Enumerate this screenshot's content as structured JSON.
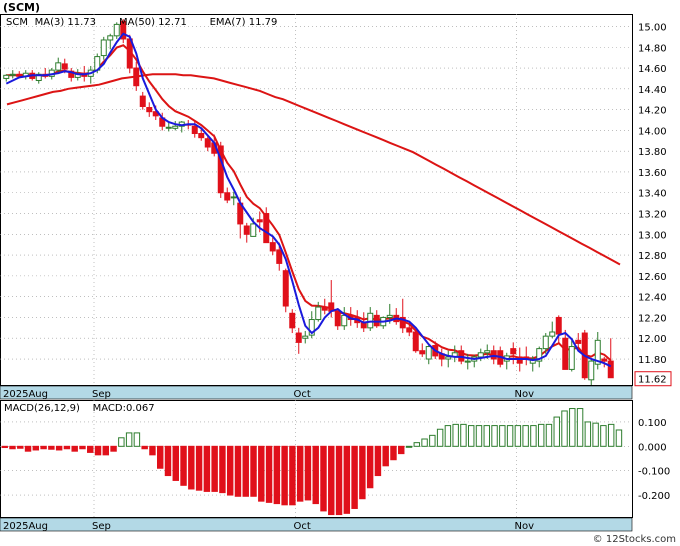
{
  "title": "(SCM)",
  "watermark": "© 12Stocks.com",
  "colors": {
    "up": "#2e7d2e",
    "down": "#e0101a",
    "ma3": "#1a1adc",
    "ma50": "#dc1414",
    "ema7": "#dc1414",
    "date_band": "#b3d9e6",
    "grid": "#999999",
    "last_price_box": "#e0101a"
  },
  "chart_data": [
    {
      "type": "candlestick",
      "name": "price",
      "legend": [
        {
          "label": "SCM",
          "value": ""
        },
        {
          "label": "MA(3)",
          "value": "11.73"
        },
        {
          "label": "MA(50)",
          "value": "12.71"
        },
        {
          "label": "EMA(7)",
          "value": "11.79"
        }
      ],
      "ylim": [
        11.55,
        15.12
      ],
      "y_ticks": [
        "15.00",
        "14.80",
        "14.60",
        "14.40",
        "14.20",
        "14.00",
        "13.80",
        "13.60",
        "13.40",
        "13.20",
        "13.00",
        "12.80",
        "12.60",
        "12.40",
        "12.20",
        "12.00",
        "11.80"
      ],
      "x_labels": [
        {
          "label": "2025Aug",
          "index": 0
        },
        {
          "label": "Sep",
          "index": 14
        },
        {
          "label": "Oct",
          "index": 45
        },
        {
          "label": "Nov",
          "index": 79
        }
      ],
      "last_price": "11.62",
      "candles": [
        [
          14.5,
          14.54,
          14.47,
          14.53
        ],
        [
          14.53,
          14.58,
          14.5,
          14.54
        ],
        [
          14.54,
          14.57,
          14.5,
          14.52
        ],
        [
          14.52,
          14.58,
          14.49,
          14.55
        ],
        [
          14.55,
          14.58,
          14.48,
          14.5
        ],
        [
          14.48,
          14.56,
          14.45,
          14.54
        ],
        [
          14.54,
          14.6,
          14.5,
          14.52
        ],
        [
          14.52,
          14.6,
          14.49,
          14.58
        ],
        [
          14.58,
          14.7,
          14.55,
          14.65
        ],
        [
          14.64,
          14.69,
          14.55,
          14.59
        ],
        [
          14.57,
          14.6,
          14.47,
          14.51
        ],
        [
          14.51,
          14.59,
          14.48,
          14.54
        ],
        [
          14.54,
          14.62,
          14.47,
          14.52
        ],
        [
          14.52,
          14.62,
          14.45,
          14.58
        ],
        [
          14.58,
          14.74,
          14.55,
          14.71
        ],
        [
          14.72,
          14.9,
          14.68,
          14.87
        ],
        [
          14.87,
          14.93,
          14.78,
          14.91
        ],
        [
          14.91,
          15.04,
          14.88,
          15.02
        ],
        [
          15.05,
          15.07,
          14.84,
          14.88
        ],
        [
          14.88,
          14.92,
          14.55,
          14.6
        ],
        [
          14.6,
          14.66,
          14.38,
          14.43
        ],
        [
          14.33,
          14.37,
          14.2,
          14.23
        ],
        [
          14.22,
          14.27,
          14.13,
          14.18
        ],
        [
          14.18,
          14.24,
          14.1,
          14.14
        ],
        [
          14.12,
          14.17,
          14.0,
          14.04
        ],
        [
          14.03,
          14.08,
          13.99,
          14.03
        ],
        [
          14.02,
          14.09,
          14.0,
          14.04
        ],
        [
          14.04,
          14.09,
          13.98,
          14.08
        ],
        [
          14.06,
          14.1,
          14.01,
          14.05
        ],
        [
          14.04,
          14.09,
          13.93,
          13.97
        ],
        [
          13.97,
          14.02,
          13.9,
          13.93
        ],
        [
          13.92,
          13.96,
          13.8,
          13.84
        ],
        [
          13.88,
          13.96,
          13.75,
          13.78
        ],
        [
          13.85,
          13.89,
          13.35,
          13.4
        ],
        [
          13.4,
          13.45,
          13.3,
          13.33
        ],
        [
          13.36,
          13.41,
          13.28,
          13.36
        ],
        [
          13.3,
          13.36,
          12.96,
          13.1
        ],
        [
          13.08,
          13.11,
          12.92,
          13.0
        ],
        [
          12.98,
          13.16,
          12.98,
          13.1
        ],
        [
          13.14,
          13.22,
          13.02,
          13.12
        ],
        [
          13.2,
          13.26,
          12.92,
          12.92
        ],
        [
          12.92,
          12.98,
          12.8,
          12.84
        ],
        [
          12.85,
          12.92,
          12.65,
          12.72
        ],
        [
          12.65,
          12.67,
          12.25,
          12.31
        ],
        [
          12.24,
          12.28,
          12.05,
          12.1
        ],
        [
          12.05,
          12.1,
          11.85,
          11.96
        ],
        [
          12.0,
          12.07,
          11.95,
          12.02
        ],
        [
          12.03,
          12.26,
          12.0,
          12.18
        ],
        [
          12.18,
          12.35,
          12.16,
          12.3
        ],
        [
          12.3,
          12.38,
          12.23,
          12.27
        ],
        [
          12.34,
          12.56,
          12.2,
          12.26
        ],
        [
          12.26,
          12.29,
          12.08,
          12.12
        ],
        [
          12.12,
          12.3,
          12.08,
          12.22
        ],
        [
          12.22,
          12.3,
          12.12,
          12.18
        ],
        [
          12.2,
          12.27,
          12.1,
          12.15
        ],
        [
          12.15,
          12.25,
          12.06,
          12.1
        ],
        [
          12.1,
          12.3,
          12.07,
          12.24
        ],
        [
          12.22,
          12.27,
          12.1,
          12.12
        ],
        [
          12.12,
          12.21,
          12.09,
          12.2
        ],
        [
          12.2,
          12.33,
          12.14,
          12.22
        ],
        [
          12.22,
          12.29,
          12.13,
          12.16
        ],
        [
          12.2,
          12.38,
          12.05,
          12.1
        ],
        [
          12.1,
          12.15,
          12.02,
          12.06
        ],
        [
          12.06,
          12.08,
          11.86,
          11.88
        ],
        [
          11.88,
          11.95,
          11.82,
          11.85
        ],
        [
          11.8,
          11.94,
          11.75,
          11.92
        ],
        [
          11.93,
          11.97,
          11.8,
          11.83
        ],
        [
          11.85,
          11.9,
          11.73,
          11.8
        ],
        [
          11.8,
          11.88,
          11.72,
          11.82
        ],
        [
          11.82,
          11.93,
          11.77,
          11.86
        ],
        [
          11.88,
          11.93,
          11.75,
          11.78
        ],
        [
          11.77,
          11.85,
          11.7,
          11.78
        ],
        [
          11.78,
          11.84,
          11.72,
          11.82
        ],
        [
          11.82,
          11.9,
          11.78,
          11.86
        ],
        [
          11.86,
          11.94,
          11.8,
          11.88
        ],
        [
          11.88,
          11.93,
          11.75,
          11.8
        ],
        [
          11.88,
          11.92,
          11.72,
          11.75
        ],
        [
          11.78,
          11.86,
          11.7,
          11.83
        ],
        [
          11.9,
          11.96,
          11.75,
          11.85
        ],
        [
          11.82,
          11.91,
          11.68,
          11.76
        ],
        [
          11.82,
          11.92,
          11.74,
          11.8
        ],
        [
          11.76,
          11.83,
          11.68,
          11.8
        ],
        [
          11.78,
          11.92,
          11.72,
          11.9
        ],
        [
          11.9,
          12.05,
          11.85,
          12.02
        ],
        [
          12.02,
          12.16,
          12.0,
          12.06
        ],
        [
          12.2,
          12.22,
          11.95,
          12.04
        ],
        [
          12.0,
          12.08,
          11.7,
          11.7
        ],
        [
          11.7,
          11.98,
          11.68,
          11.92
        ],
        [
          11.98,
          12.05,
          11.88,
          11.95
        ],
        [
          12.05,
          12.08,
          11.6,
          11.62
        ],
        [
          11.6,
          11.8,
          11.55,
          11.78
        ],
        [
          11.75,
          12.06,
          11.7,
          11.98
        ],
        [
          11.8,
          11.82,
          11.72,
          11.78
        ],
        [
          11.78,
          12.0,
          11.62,
          11.62
        ]
      ],
      "ma3_values": [
        14.45,
        14.48,
        14.51,
        14.52,
        14.53,
        14.53,
        14.53,
        14.54,
        14.55,
        14.57,
        14.56,
        14.54,
        14.54,
        14.55,
        14.58,
        14.64,
        14.75,
        14.85,
        14.93,
        14.9,
        14.74,
        14.5,
        14.35,
        14.2,
        14.12,
        14.08,
        14.06,
        14.05,
        14.06,
        14.06,
        14.02,
        13.95,
        13.88,
        13.72,
        13.55,
        13.43,
        13.3,
        13.21,
        13.12,
        13.06,
        13.02,
        12.98,
        12.9,
        12.76,
        12.55,
        12.32,
        12.12,
        12.05,
        12.1,
        12.2,
        12.26,
        12.28,
        12.23,
        12.19,
        12.18,
        12.15,
        12.16,
        12.16,
        12.16,
        12.17,
        12.19,
        12.18,
        12.16,
        12.1,
        12.02,
        11.94,
        11.88,
        11.85,
        11.83,
        11.82,
        11.82,
        11.81,
        11.8,
        11.81,
        11.82,
        11.83,
        11.82,
        11.8,
        11.8,
        11.8,
        11.8,
        11.79,
        11.8,
        11.83,
        11.93,
        12.03,
        12.05,
        11.99,
        11.88,
        11.83,
        11.8,
        11.78,
        11.76,
        11.73
      ],
      "ma50_values": [
        14.25,
        14.27,
        14.29,
        14.31,
        14.33,
        14.35,
        14.37,
        14.38,
        14.4,
        14.41,
        14.42,
        14.43,
        14.44,
        14.46,
        14.48,
        14.5,
        14.51,
        14.52,
        14.53,
        14.54,
        14.54,
        14.54,
        14.54,
        14.53,
        14.53,
        14.52,
        14.51,
        14.5,
        14.48,
        14.46,
        14.44,
        14.42,
        14.4,
        14.38,
        14.35,
        14.32,
        14.3,
        14.27,
        14.24,
        14.21,
        14.18,
        14.15,
        14.12,
        14.09,
        14.06,
        14.03,
        14.0,
        13.97,
        13.94,
        13.91,
        13.88,
        13.85,
        13.82,
        13.79,
        13.75,
        13.71,
        13.67,
        13.63,
        13.59,
        13.55,
        13.51,
        13.47,
        13.43,
        13.39,
        13.35,
        13.31,
        13.27,
        13.23,
        13.19,
        13.15,
        13.11,
        13.07,
        13.03,
        12.99,
        12.95,
        12.91,
        12.87,
        12.83,
        12.79,
        12.75,
        12.71
      ]
    },
    {
      "type": "bar",
      "name": "MACD",
      "legend": [
        {
          "label": "MACD(26,12,9)",
          "value": ""
        },
        {
          "label": "MACD",
          "value": "0.067"
        }
      ],
      "ylim": [
        -0.29,
        0.19
      ],
      "y_ticks": [
        "0.100",
        "0.000",
        "-0.100",
        "-0.200"
      ],
      "x_labels": [
        {
          "label": "2025Aug",
          "index": 0
        },
        {
          "label": "Sep",
          "index": 14
        },
        {
          "label": "Oct",
          "index": 45
        },
        {
          "label": "Nov",
          "index": 79
        }
      ],
      "values": [
        -0.005,
        -0.01,
        -0.008,
        -0.02,
        -0.015,
        -0.01,
        -0.012,
        -0.015,
        -0.01,
        -0.02,
        -0.01,
        -0.025,
        -0.035,
        -0.035,
        -0.02,
        0.035,
        0.055,
        0.055,
        -0.01,
        -0.035,
        -0.09,
        -0.12,
        -0.14,
        -0.16,
        -0.175,
        -0.18,
        -0.185,
        -0.185,
        -0.19,
        -0.2,
        -0.205,
        -0.205,
        -0.205,
        -0.225,
        -0.23,
        -0.235,
        -0.24,
        -0.24,
        -0.225,
        -0.22,
        -0.235,
        -0.265,
        -0.28,
        -0.28,
        -0.275,
        -0.255,
        -0.215,
        -0.17,
        -0.12,
        -0.08,
        -0.055,
        -0.03,
        0.0,
        0.015,
        0.03,
        0.045,
        0.07,
        0.085,
        0.09,
        0.09,
        0.085,
        0.085,
        0.085,
        0.085,
        0.085,
        0.085,
        0.085,
        0.085,
        0.085,
        0.09,
        0.09,
        0.12,
        0.145,
        0.155,
        0.155,
        0.1,
        0.095,
        0.085,
        0.09,
        0.067
      ]
    }
  ]
}
